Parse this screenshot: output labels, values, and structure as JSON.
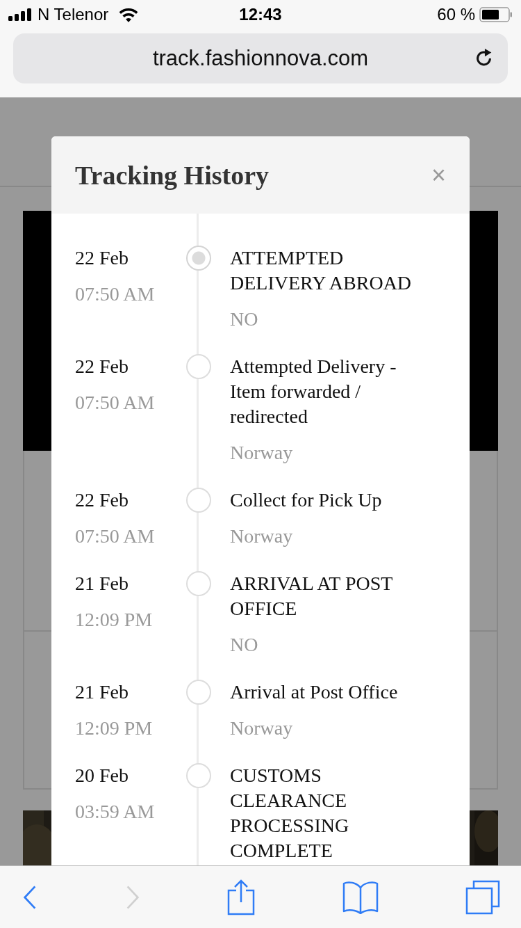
{
  "status_bar": {
    "carrier": "N Telenor",
    "time": "12:43",
    "battery": "60 %"
  },
  "browser": {
    "url": "track.fashionnova.com"
  },
  "modal": {
    "title": "Tracking History",
    "close": "×",
    "events": [
      {
        "date": "22 Feb",
        "time": "07:50 AM",
        "title": "ATTEMPTED DELIVERY ABROAD",
        "location": "NO",
        "active": true
      },
      {
        "date": "22 Feb",
        "time": "07:50 AM",
        "title": "Attempted Delivery - Item forwarded / redirected",
        "location": "Norway",
        "active": false
      },
      {
        "date": "22 Feb",
        "time": "07:50 AM",
        "title": "Collect for Pick Up",
        "location": "Norway",
        "active": false
      },
      {
        "date": "21 Feb",
        "time": "12:09 PM",
        "title": "ARRIVAL AT POST OFFICE",
        "location": "NO",
        "active": false
      },
      {
        "date": "21 Feb",
        "time": "12:09 PM",
        "title": "Arrival at Post Office",
        "location": "Norway",
        "active": false
      },
      {
        "date": "20 Feb",
        "time": "03:59 AM",
        "title": "CUSTOMS CLEARANCE PROCESSING COMPLETE",
        "active": false
      }
    ]
  },
  "toolbar": [
    {
      "kind": "back",
      "disabled": false
    },
    {
      "kind": "forward",
      "disabled": true
    },
    {
      "kind": "share",
      "disabled": false
    },
    {
      "kind": "bookmarks",
      "disabled": false
    },
    {
      "kind": "tabs",
      "disabled": false
    }
  ]
}
